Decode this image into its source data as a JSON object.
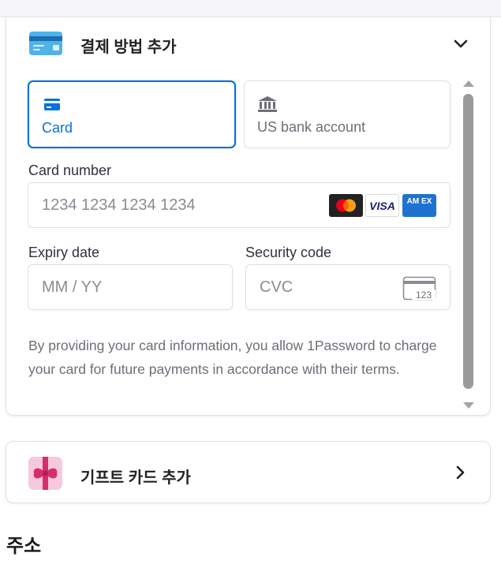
{
  "payment": {
    "title": "결제 방법 추가",
    "header_icon": "credit-card-icon",
    "toggle_icon": "chevron-down-icon",
    "tabs": [
      {
        "label": "Card",
        "icon": "card-icon",
        "selected": true
      },
      {
        "label": "US bank account",
        "icon": "bank-icon",
        "selected": false
      }
    ],
    "card_number": {
      "label": "Card number",
      "placeholder": "1234 1234 1234 1234"
    },
    "brands": [
      {
        "name": "mastercard",
        "label": ""
      },
      {
        "name": "visa",
        "label": "VISA"
      },
      {
        "name": "amex",
        "label": "AM EX"
      }
    ],
    "expiry": {
      "label": "Expiry date",
      "placeholder": "MM / YY"
    },
    "security": {
      "label": "Security code",
      "placeholder": "CVC",
      "icon_text": "123"
    },
    "legal_text": "By providing your card information, you allow 1Password to charge your card for future payments in accordance with their terms.",
    "accent_color": "#0570de"
  },
  "gift": {
    "title": "기프트 카드 추가",
    "icon": "gift-icon",
    "arrow_icon": "chevron-right-icon"
  },
  "address": {
    "title": "주소"
  }
}
